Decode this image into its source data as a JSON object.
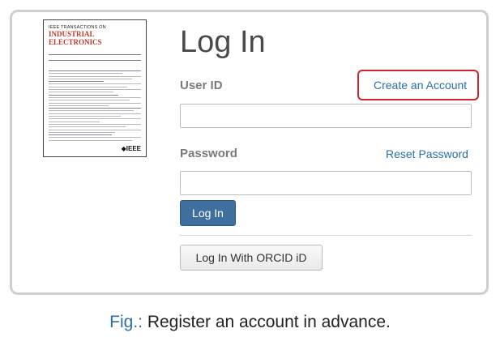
{
  "cover": {
    "top_line": "IEEE TRANSACTIONS ON",
    "journal_line1": "INDUSTRIAL",
    "journal_line2": "ELECTRONICS",
    "logo": "◆IEEE"
  },
  "login": {
    "title": "Log In",
    "user_id_label": "User ID",
    "create_account_link": "Create an Account",
    "user_id_value": "",
    "password_label": "Password",
    "reset_password_link": "Reset Password",
    "password_value": "",
    "login_button": "Log In",
    "orcid_button": "Log In With ORCID iD"
  },
  "caption": {
    "prefix": "Fig.:",
    "text": " Register an account in advance."
  },
  "colors": {
    "link": "#2a6fad",
    "primary_button": "#3f6f9e",
    "highlight_box": "#d0212e",
    "cover_title": "#c0392b"
  }
}
